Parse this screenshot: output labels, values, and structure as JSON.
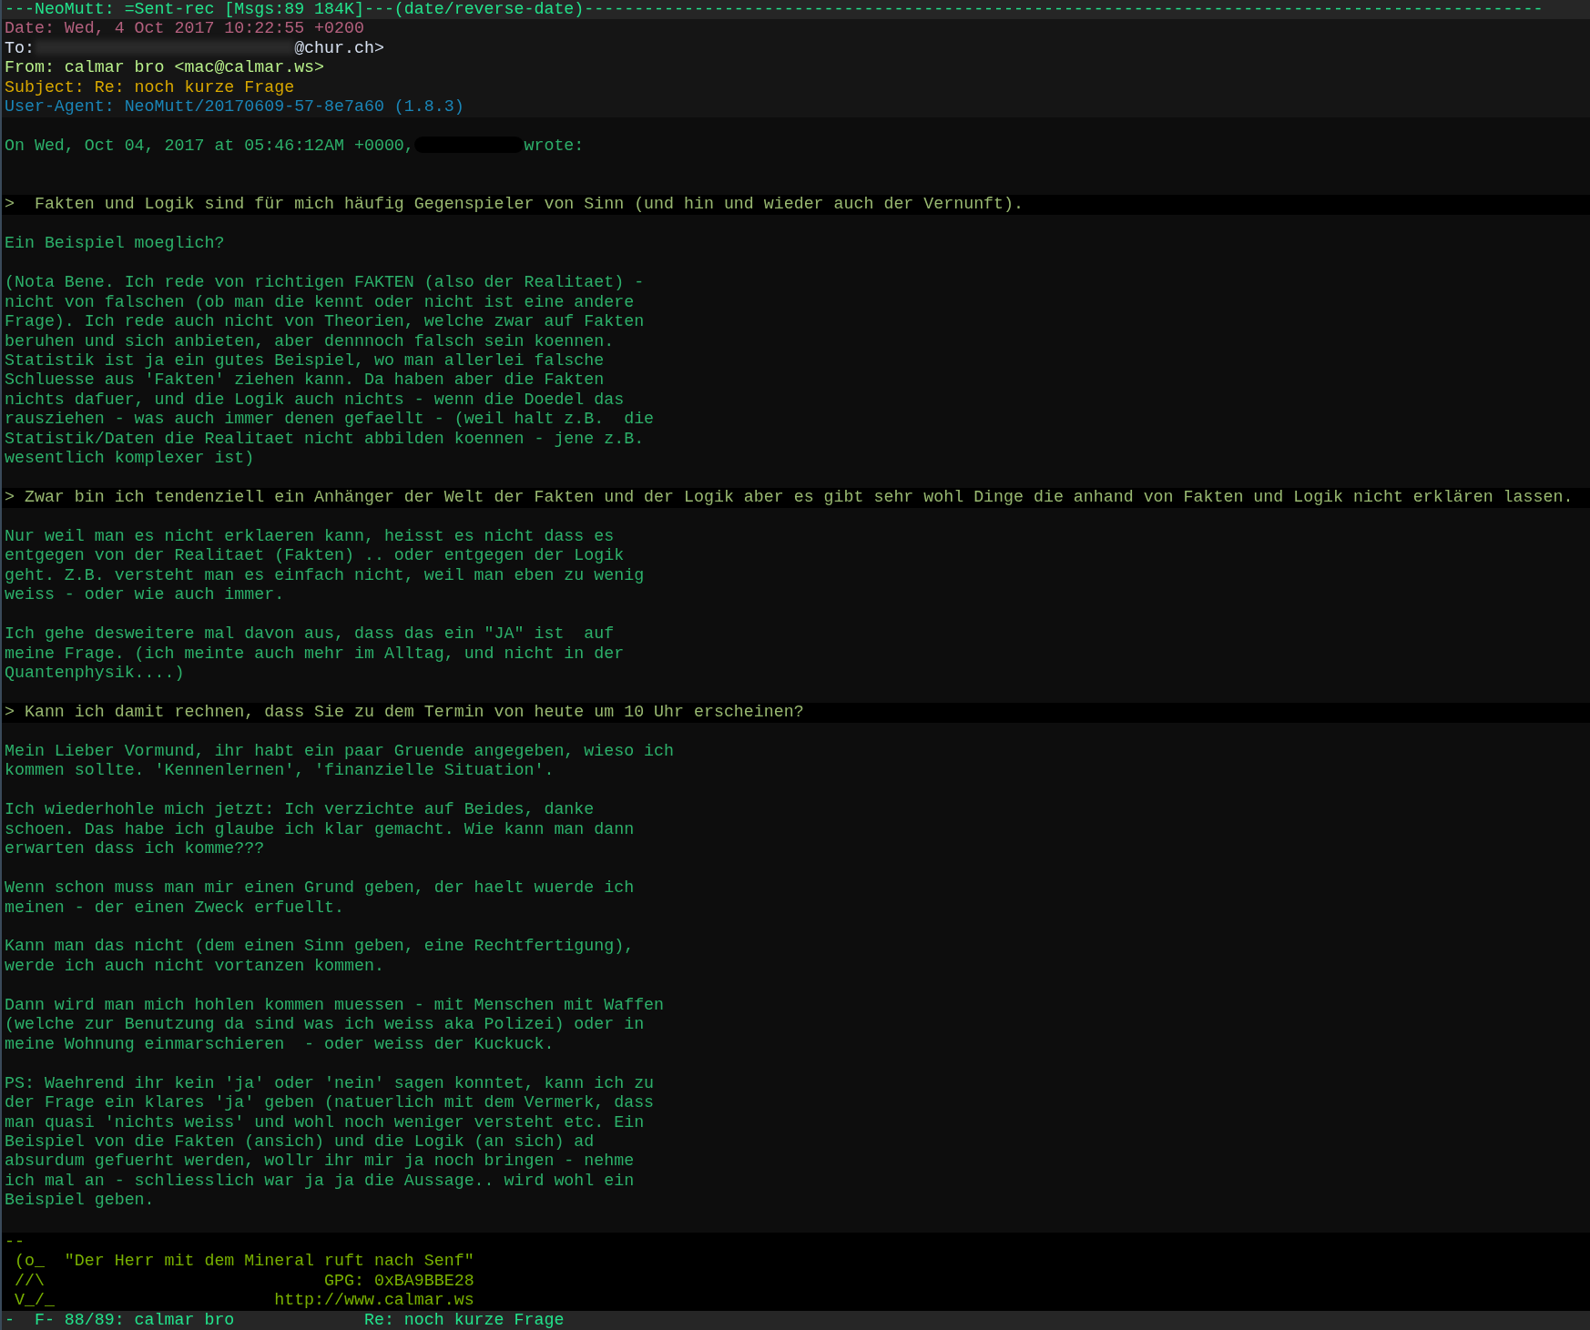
{
  "status_bar": {
    "text": "---NeoMutt: =Sent-rec [Msgs:89 184K]---(date/reverse-date)------------------------------------------------------------------------------------------------"
  },
  "headers": [
    {
      "kind": "date",
      "text": "Date: Wed, 4 Oct 2017 10:22:55 +0200"
    },
    {
      "kind": "to",
      "label": "To:",
      "redacted": true,
      "text": "@chur.ch>"
    },
    {
      "kind": "from",
      "text": "From: calmar bro <mac@calmar.ws>"
    },
    {
      "kind": "subject",
      "text": "Subject: Re: noch kurze Frage"
    },
    {
      "kind": "agent",
      "text": "User-Agent: NeoMutt/20170609-57-8e7a60 (1.8.3)"
    }
  ],
  "body": [
    {
      "kind": "attribution",
      "before": "On Wed, Oct 04, 2017 at 05:46:12AM +0000,",
      "redacted": true,
      "after": "wrote:"
    },
    {
      "kind": "quote",
      "lines": [
        ">  Fakten und Logik sind für mich häufig Gegenspieler von Sinn (und hin und wieder auch der Vernunft)."
      ]
    },
    {
      "kind": "text",
      "lines": [
        "Ein Beispiel moeglich?"
      ]
    },
    {
      "kind": "text",
      "lines": [
        "(Nota Bene. Ich rede von richtigen FAKTEN (also der Realitaet) -",
        "nicht von falschen (ob man die kennt oder nicht ist eine andere",
        "Frage). Ich rede auch nicht von Theorien, welche zwar auf Fakten",
        "beruhen und sich anbieten, aber dennnoch falsch sein koennen.",
        "Statistik ist ja ein gutes Beispiel, wo man allerlei falsche",
        "Schluesse aus 'Fakten' ziehen kann. Da haben aber die Fakten",
        "nichts dafuer, und die Logik auch nichts - wenn die Doedel das",
        "rausziehen - was auch immer denen gefaellt - (weil halt z.B.  die",
        "Statistik/Daten die Realitaet nicht abbilden koennen - jene z.B.",
        "wesentlich komplexer ist)"
      ]
    },
    {
      "kind": "quote",
      "lines": [
        "> Zwar bin ich tendenziell ein Anhänger der Welt der Fakten und der Logik aber es gibt sehr wohl Dinge die anhand von Fakten und Logik nicht erklären lassen."
      ]
    },
    {
      "kind": "text",
      "lines": [
        "Nur weil man es nicht erklaeren kann, heisst es nicht dass es",
        "entgegen von der Realitaet (Fakten) .. oder entgegen der Logik",
        "geht. Z.B. versteht man es einfach nicht, weil man eben zu wenig",
        "weiss - oder wie auch immer."
      ]
    },
    {
      "kind": "text",
      "lines": [
        "Ich gehe desweitere mal davon aus, dass das ein \"JA\" ist  auf",
        "meine Frage. (ich meinte auch mehr im Alltag, und nicht in der",
        "Quantenphysik....)"
      ]
    },
    {
      "kind": "quote",
      "lines": [
        "> Kann ich damit rechnen, dass Sie zu dem Termin von heute um 10 Uhr erscheinen?"
      ]
    },
    {
      "kind": "text",
      "lines": [
        "Mein Lieber Vormund, ihr habt ein paar Gruende angegeben, wieso ich",
        "kommen sollte. 'Kennenlernen', 'finanzielle Situation'."
      ]
    },
    {
      "kind": "text",
      "lines": [
        "Ich wiederhohle mich jetzt: Ich verzichte auf Beides, danke",
        "schoen. Das habe ich glaube ich klar gemacht. Wie kann man dann",
        "erwarten dass ich komme???"
      ]
    },
    {
      "kind": "text",
      "lines": [
        "Wenn schon muss man mir einen Grund geben, der haelt wuerde ich",
        "meinen - der einen Zweck erfuellt."
      ]
    },
    {
      "kind": "text",
      "lines": [
        "Kann man das nicht (dem einen Sinn geben, eine Rechtfertigung),",
        "werde ich auch nicht vortanzen kommen."
      ]
    },
    {
      "kind": "text",
      "lines": [
        "Dann wird man mich hohlen kommen muessen - mit Menschen mit Waffen",
        "(welche zur Benutzung da sind was ich weiss aka Polizei) oder in",
        "meine Wohnung einmarschieren  - oder weiss der Kuckuck."
      ]
    },
    {
      "kind": "text",
      "lines": [
        "PS: Waehrend ihr kein 'ja' oder 'nein' sagen konntet, kann ich zu",
        "der Frage ein klares 'ja' geben (natuerlich mit dem Vermerk, dass",
        "man quasi 'nichts weiss' und wohl noch weniger versteht etc. Ein",
        "Beispiel von die Fakten (ansich) und die Logik (an sich) ad",
        "absurdum gefuerht werden, wollr ihr mir ja noch bringen - nehme",
        "ich mal an - schliesslich war ja ja die Aussage.. wird wohl ein",
        "Beispiel geben."
      ]
    }
  ],
  "signature": {
    "lines": [
      "--",
      " (o_  \"Der Herr mit dem Mineral ruft nach Senf\"",
      " //\\                            GPG: 0xBA9BBE28",
      " V_/_                      http://www.calmar.ws"
    ]
  },
  "index_bar": {
    "text": "-  F- 88/89: calmar bro             Re: noch kurze Frage"
  }
}
